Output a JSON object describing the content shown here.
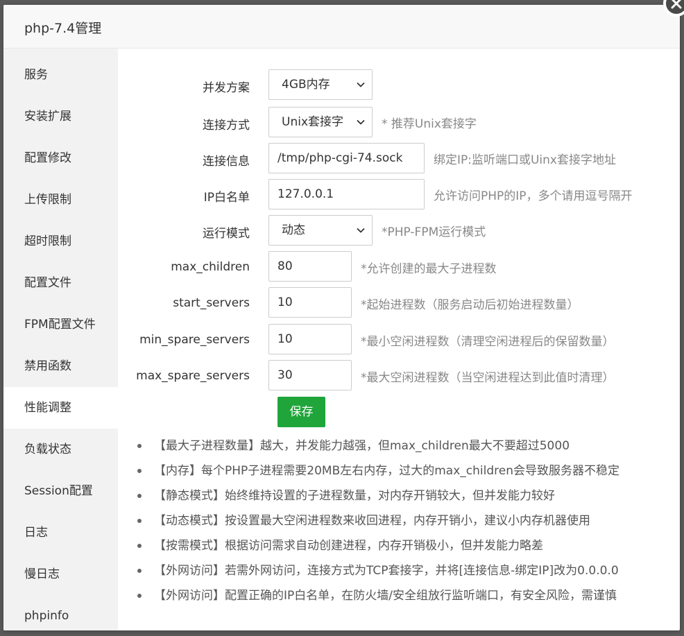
{
  "dialog": {
    "title": "php-7.4管理"
  },
  "sidebar": {
    "items": [
      {
        "label": "服务"
      },
      {
        "label": "安装扩展"
      },
      {
        "label": "配置修改"
      },
      {
        "label": "上传限制"
      },
      {
        "label": "超时限制"
      },
      {
        "label": "配置文件"
      },
      {
        "label": "FPM配置文件"
      },
      {
        "label": "禁用函数"
      },
      {
        "label": "性能调整"
      },
      {
        "label": "负载状态"
      },
      {
        "label": "Session配置"
      },
      {
        "label": "日志"
      },
      {
        "label": "慢日志"
      },
      {
        "label": "phpinfo"
      }
    ],
    "active_index": 8
  },
  "form": {
    "concurrency_label": "并发方案",
    "concurrency_value": "4GB内存",
    "conn_method_label": "连接方式",
    "conn_method_value": "Unix套接字",
    "conn_method_hint": "* 推荐Unix套接字",
    "conn_info_label": "连接信息",
    "conn_info_value": "/tmp/php-cgi-74.sock",
    "conn_info_hint": "绑定IP:监听端口或Uinx套接字地址",
    "ip_whitelist_label": "IP白名单",
    "ip_whitelist_value": "127.0.0.1",
    "ip_whitelist_hint": "允许访问PHP的IP，多个请用逗号隔开",
    "run_mode_label": "运行模式",
    "run_mode_value": "动态",
    "run_mode_hint": "*PHP-FPM运行模式",
    "max_children_label": "max_children",
    "max_children_value": "80",
    "max_children_hint": "*允许创建的最大子进程数",
    "start_servers_label": "start_servers",
    "start_servers_value": "10",
    "start_servers_hint": "*起始进程数（服务启动后初始进程数量）",
    "min_spare_label": "min_spare_servers",
    "min_spare_value": "10",
    "min_spare_hint": "*最小空闲进程数（清理空闲进程后的保留数量）",
    "max_spare_label": "max_spare_servers",
    "max_spare_value": "30",
    "max_spare_hint": "*最大空闲进程数（当空闲进程达到此值时清理）",
    "save_label": "保存"
  },
  "tips": [
    "【最大子进程数量】越大，并发能力越强，但max_children最大不要超过5000",
    "【内存】每个PHP子进程需要20MB左右内存，过大的max_children会导致服务器不稳定",
    "【静态模式】始终维持设置的子进程数量，对内存开销较大，但并发能力较好",
    "【动态模式】按设置最大空闲进程数来收回进程，内存开销小，建议小内存机器使用",
    "【按需模式】根据访问需求自动创建进程，内存开销极小，但并发能力略差",
    "【外网访问】若需外网访问，连接方式为TCP套接字，并将[连接信息-绑定IP]改为0.0.0.0",
    "【外网访问】配置正确的IP白名单，在防火墙/安全组放行监听端口，有安全风险，需谨慎"
  ],
  "colors": {
    "accent": "#20a53a",
    "sidebar_bg": "#f2f2f2",
    "overlay": "#5a5a5a"
  }
}
